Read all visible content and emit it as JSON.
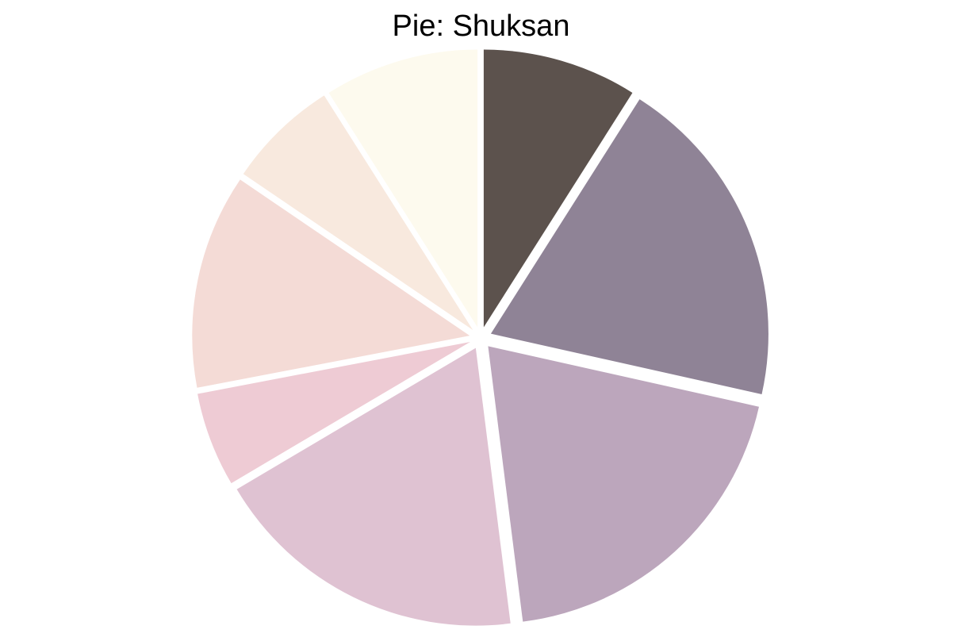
{
  "chart_data": {
    "type": "pie",
    "title": "Pie: Shuksan",
    "start_angle_deg": 90,
    "direction": "clockwise",
    "exploded": true,
    "slices": [
      {
        "value": 9.0,
        "color": "#5c524d"
      },
      {
        "value": 19.5,
        "color": "#8f8396"
      },
      {
        "value": 19.5,
        "color": "#bca6bc"
      },
      {
        "value": 18.5,
        "color": "#dfc2d2"
      },
      {
        "value": 5.5,
        "color": "#eecbd4"
      },
      {
        "value": 12.5,
        "color": "#f4dbd6"
      },
      {
        "value": 6.5,
        "color": "#f8e9de"
      },
      {
        "value": 9.0,
        "color": "#fdfaee"
      }
    ]
  }
}
